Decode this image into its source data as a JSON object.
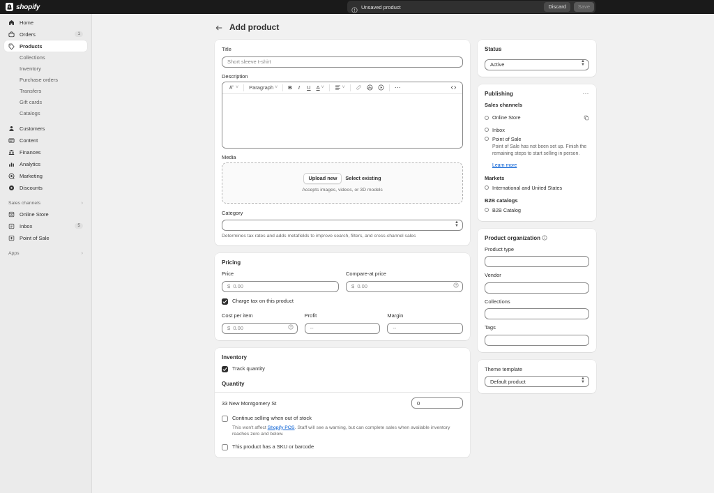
{
  "topbar": {
    "brand_name": "shopify",
    "brand_mark_icon": "shopify-bag-icon",
    "save_bar": {
      "status_icon": "info-circle-icon",
      "status_text": "Unsaved product",
      "discard_label": "Discard",
      "save_label": "Save"
    }
  },
  "sidebar": {
    "items": [
      {
        "label": "Home",
        "icon": "home-icon",
        "active": false,
        "badge": ""
      },
      {
        "label": "Orders",
        "icon": "orders-bag-icon",
        "active": false,
        "badge": "1"
      },
      {
        "label": "Products",
        "icon": "products-tag-icon",
        "active": true,
        "badge": ""
      }
    ],
    "product_subitems": [
      {
        "label": "Collections"
      },
      {
        "label": "Inventory"
      },
      {
        "label": "Purchase orders"
      },
      {
        "label": "Transfers"
      },
      {
        "label": "Gift cards"
      },
      {
        "label": "Catalogs"
      }
    ],
    "items2": [
      {
        "label": "Customers",
        "icon": "person-icon",
        "badge": ""
      },
      {
        "label": "Content",
        "icon": "content-icon",
        "badge": ""
      },
      {
        "label": "Finances",
        "icon": "bank-icon",
        "badge": ""
      },
      {
        "label": "Analytics",
        "icon": "bar-chart-icon",
        "badge": ""
      },
      {
        "label": "Marketing",
        "icon": "megaphone-icon",
        "badge": ""
      },
      {
        "label": "Discounts",
        "icon": "discount-icon",
        "badge": ""
      }
    ],
    "sales_channels_header": "Sales channels",
    "sales_channels": [
      {
        "label": "Online Store",
        "icon": "storefront-icon",
        "badge": ""
      },
      {
        "label": "Inbox",
        "icon": "inbox-icon",
        "badge": "5"
      },
      {
        "label": "Point of Sale",
        "icon": "pos-icon",
        "badge": ""
      }
    ],
    "apps_header": "Apps"
  },
  "page": {
    "back_icon": "arrow-left-icon",
    "title": "Add product"
  },
  "product": {
    "title_label": "Title",
    "title_placeholder": "Short sleeve t-shirt",
    "title_value": "",
    "description_label": "Description",
    "description_value": "",
    "editor_toolbar": {
      "format_icon": "text-styles-icon",
      "paragraph_label": "Paragraph",
      "bold_label": "B",
      "italic_label": "I",
      "underline_label": "U",
      "text_color_label": "A",
      "align_icon": "align-left-icon",
      "link_icon": "link-icon",
      "image_icon": "insert-image-icon",
      "video_icon": "insert-video-icon",
      "more_icon": "ellipsis-icon",
      "code_icon": "code-view-icon"
    },
    "media_label": "Media",
    "media_upload_label": "Upload new",
    "media_select_label": "Select existing",
    "media_hint": "Accepts images, videos, or 3D models",
    "category_label": "Category",
    "category_value": "",
    "category_help": "Determines tax rates and adds metafields to improve search, filters, and cross-channel sales"
  },
  "pricing": {
    "heading": "Pricing",
    "price_label": "Price",
    "price_placeholder": "$  0.00",
    "compare_label": "Compare-at price",
    "compare_placeholder": "$  0.00",
    "compare_info_icon": "question-circle-icon",
    "charge_tax_label": "Charge tax on this product",
    "charge_tax_checked": true,
    "cost_label": "Cost per item",
    "cost_placeholder": "$  0.00",
    "cost_info_icon": "question-circle-icon",
    "profit_label": "Profit",
    "profit_placeholder": "--",
    "margin_label": "Margin",
    "margin_placeholder": "--"
  },
  "inventory": {
    "heading": "Inventory",
    "track_quantity_label": "Track quantity",
    "track_quantity_checked": true,
    "quantity_heading": "Quantity",
    "location_name": "33 New Montgomery St",
    "location_quantity": "0",
    "continue_selling_label": "Continue selling when out of stock",
    "continue_selling_checked": false,
    "continue_selling_help_pre": "This won't affect ",
    "continue_selling_help_link": "Shopify POS",
    "continue_selling_help_post": ". Staff will see a warning, but can complete sales when available inventory reaches zero and below.",
    "sku_label": "This product has a SKU or barcode",
    "sku_checked": false
  },
  "status": {
    "heading": "Status",
    "value": "Active"
  },
  "publishing": {
    "heading": "Publishing",
    "more_icon": "ellipsis-icon",
    "sales_channels_heading": "Sales channels",
    "channels": [
      {
        "name": "Online Store",
        "trailing_icon": "duplicate-icon",
        "description": "",
        "learn_more": ""
      },
      {
        "name": "Inbox",
        "trailing_icon": "",
        "description": "",
        "learn_more": ""
      },
      {
        "name": "Point of Sale",
        "trailing_icon": "",
        "description": "Point of Sale has not been set up. Finish the remaining steps to start selling in person.",
        "learn_more": "Learn more"
      }
    ],
    "markets_heading": "Markets",
    "markets": [
      {
        "name": "International and United States"
      }
    ],
    "b2b_heading": "B2B catalogs",
    "b2b": [
      {
        "name": "B2B Catalog"
      }
    ]
  },
  "organization": {
    "heading": "Product organization",
    "info_icon": "info-circle-icon",
    "fields": [
      {
        "label": "Product type",
        "value": ""
      },
      {
        "label": "Vendor",
        "value": ""
      },
      {
        "label": "Collections",
        "value": ""
      },
      {
        "label": "Tags",
        "value": ""
      }
    ]
  },
  "theme": {
    "label": "Theme template",
    "value": "Default product"
  }
}
